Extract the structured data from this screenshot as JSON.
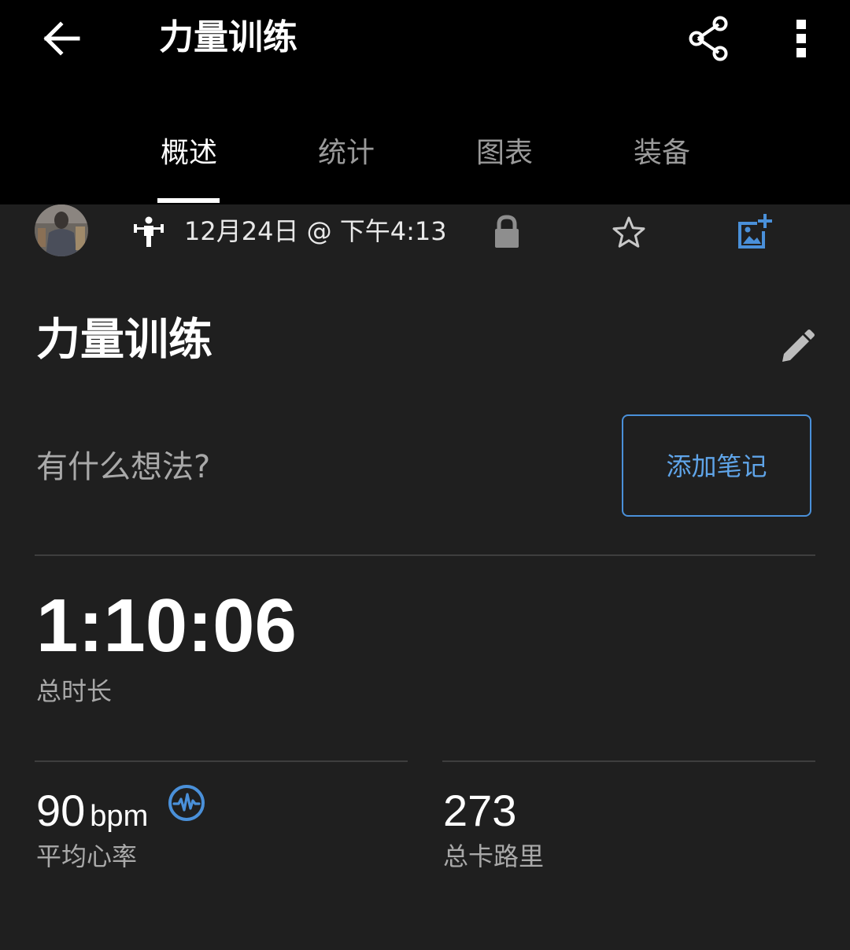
{
  "header": {
    "title": "力量训练"
  },
  "tabs": [
    {
      "label": "概述",
      "active": true
    },
    {
      "label": "统计",
      "active": false
    },
    {
      "label": "图表",
      "active": false
    },
    {
      "label": "装备",
      "active": false
    }
  ],
  "meta": {
    "datetime": "12月24日 @ 下午4:13"
  },
  "activity": {
    "name": "力量训练",
    "notes_prompt": "有什么想法?",
    "add_note_label": "添加笔记"
  },
  "stats": {
    "duration": {
      "value": "1:10:06",
      "label": "总时长"
    },
    "heart_rate": {
      "value": "90",
      "unit": "bpm",
      "label": "平均心率"
    },
    "calories": {
      "value": "273",
      "label": "总卡路里"
    }
  },
  "colors": {
    "accent": "#5fa4e8",
    "background": "#1f1f1f",
    "header_background": "#000000",
    "muted_text": "#a9a9a9"
  },
  "icons": {
    "back": "arrow-left-icon",
    "share": "share-icon",
    "more": "more-vertical-icon",
    "activity_type": "strength-training-icon",
    "privacy": "lock-icon",
    "favorite": "star-outline-icon",
    "add_photo": "add-photo-icon",
    "edit": "pencil-icon",
    "heart_rate": "heart-rate-wave-icon"
  }
}
